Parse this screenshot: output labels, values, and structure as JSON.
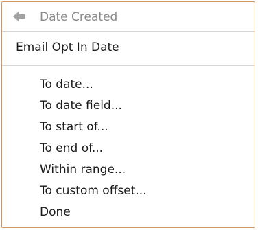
{
  "back": {
    "label": "Date Created",
    "icon": "arrow-left-icon"
  },
  "section": {
    "title": "Email Opt In Date"
  },
  "options": [
    "To date...",
    "To date field...",
    "To start of...",
    "To end of...",
    "Within range...",
    "To custom offset...",
    "Done"
  ],
  "colors": {
    "border": "#d3965a",
    "muted_text": "#8a8a8a",
    "text": "#1a1a1a",
    "divider": "#d6d6d6"
  }
}
